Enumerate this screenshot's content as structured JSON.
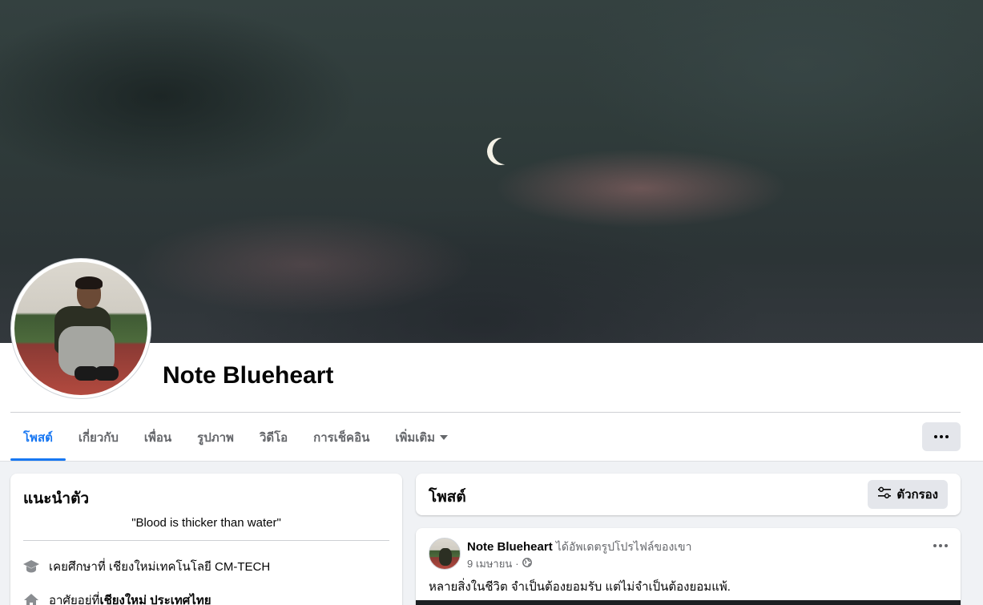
{
  "profile": {
    "name": "Note Blueheart"
  },
  "tabs": [
    {
      "label": "โพสต์",
      "active": true
    },
    {
      "label": "เกี่ยวกับ"
    },
    {
      "label": "เพื่อน"
    },
    {
      "label": "รูปภาพ"
    },
    {
      "label": "วิดีโอ"
    },
    {
      "label": "การเช็คอิน"
    },
    {
      "label": "เพิ่มเติม"
    }
  ],
  "intro": {
    "title": "แนะนำตัว",
    "bio": "\"Blood is thicker than water\"",
    "education": "เคยศึกษาที่ เชียงใหม่เทคโนโลยี CM-TECH",
    "lives_prefix": "อาศัยอยู่ที่ ",
    "lives_place": "เชียงใหม่ ประเทศไทย"
  },
  "posts": {
    "title": "โพสต์",
    "filter_label": "ตัวกรอง"
  },
  "post": {
    "author": "Note Blueheart",
    "action": "ได้อัพเดตรูปโปรไฟล์ของเขา",
    "date": "9 เมษายน",
    "separator": "·",
    "text": "หลายสิ่งในชีวิต จำเป็นต้องยอมรับ แต่ไม่จำเป็นต้องยอมแพ้."
  },
  "colors": {
    "accent": "#1877f2",
    "background": "#f0f2f5",
    "secondary_text": "#65676b"
  },
  "icons": [
    "graduation-cap-icon",
    "home-icon",
    "filter-sliders-icon",
    "globe-icon",
    "more-dots-icon",
    "caret-down-icon"
  ]
}
